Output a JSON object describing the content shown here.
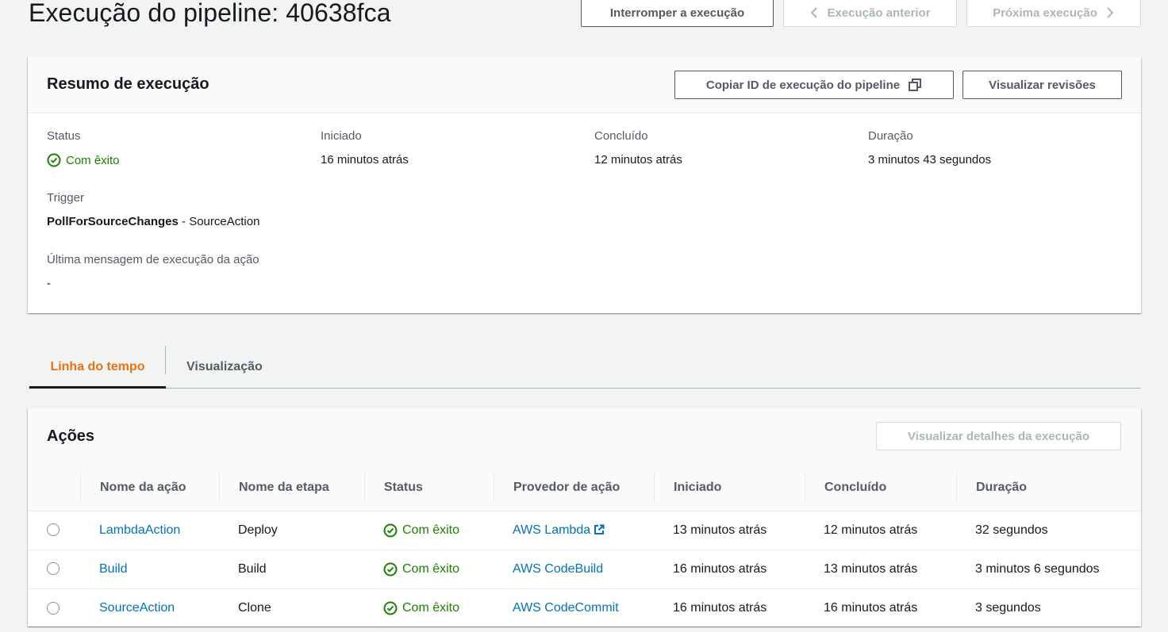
{
  "page": {
    "title": "Execução do pipeline: 40638fca",
    "stop_button": "Interromper a execução",
    "prev_button": "Execução anterior",
    "next_button": "Próxima execução"
  },
  "summary": {
    "title": "Resumo de execução",
    "copy_button": "Copiar ID de execução do pipeline",
    "revisions_button": "Visualizar revisões",
    "status_label": "Status",
    "status_value": "Com êxito",
    "started_label": "Iniciado",
    "started_value": "16 minutos atrás",
    "completed_label": "Concluído",
    "completed_value": "12 minutos atrás",
    "duration_label": "Duração",
    "duration_value": "3 minutos 43 segundos",
    "trigger_label": "Trigger",
    "trigger_bold": "PollForSourceChanges",
    "trigger_rest": " - SourceAction",
    "last_msg_label": "Última mensagem de execução da ação",
    "last_msg_value": "-"
  },
  "tabs": {
    "timeline": "Linha do tempo",
    "visualization": "Visualização"
  },
  "actions": {
    "title": "Ações",
    "details_button": "Visualizar detalhes da execução",
    "columns": [
      "Nome da ação",
      "Nome da etapa",
      "Status",
      "Provedor de ação",
      "Iniciado",
      "Concluído",
      "Duração"
    ],
    "rows": [
      {
        "name": "LambdaAction",
        "stage": "Deploy",
        "status": "Com êxito",
        "provider": "AWS Lambda",
        "started": "13 minutos atrás",
        "completed": "12 minutos atrás",
        "duration": "32 segundos"
      },
      {
        "name": "Build",
        "stage": "Build",
        "status": "Com êxito",
        "provider": "AWS CodeBuild",
        "started": "16 minutos atrás",
        "completed": "13 minutos atrás",
        "duration": "3 minutos 6 segundos"
      },
      {
        "name": "SourceAction",
        "stage": "Clone",
        "status": "Com êxito",
        "provider": "AWS CodeCommit",
        "started": "16 minutos atrás",
        "completed": "16 minutos atrás",
        "duration": "3 segundos"
      }
    ]
  },
  "colors": {
    "success": "#1d8102",
    "link": "#0073bb",
    "active_tab": "#ec7211"
  },
  "icons": [
    "check-circle-icon",
    "copy-icon",
    "chevron-left-icon",
    "chevron-right-icon",
    "external-link-icon"
  ]
}
